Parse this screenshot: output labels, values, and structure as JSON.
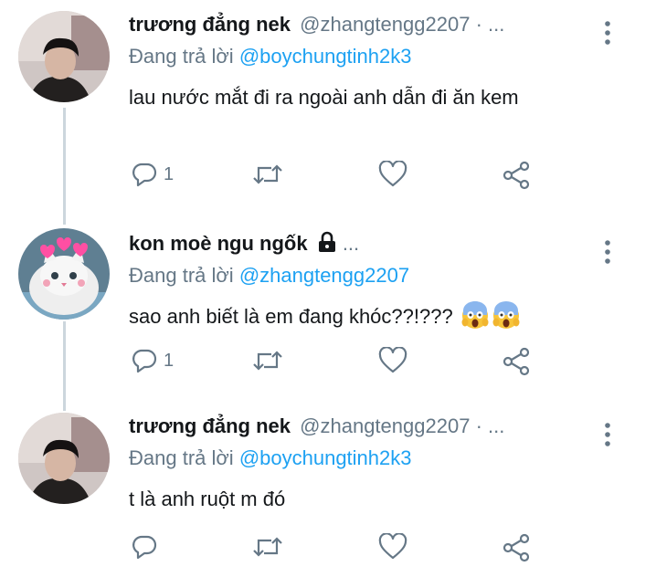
{
  "tweets": [
    {
      "name": "trương đẳng nek",
      "handle": "@zhangtengg2207",
      "meta": "· ...",
      "reply_prefix": "Đang trả lời ",
      "reply_to": "@boychungtinh2k3",
      "text": "lau nước mắt đi ra ngoài anh dẫn đi ăn kem",
      "reply_count": "1",
      "retweet_count": "",
      "like_count": ""
    },
    {
      "name": "kon moè ngu ngốk",
      "locked": true,
      "meta": "...",
      "reply_prefix": "Đang trả lời ",
      "reply_to": "@zhangtengg2207",
      "text": "sao anh biết là em đang khóc??!??? ",
      "emoji": [
        "screaming-face-emoji",
        "screaming-face-emoji"
      ],
      "reply_count": "1",
      "retweet_count": "",
      "like_count": ""
    },
    {
      "name": "trương đẳng nek",
      "handle": "@zhangtengg2207",
      "meta": "· ...",
      "reply_prefix": "Đang trả lời ",
      "reply_to": "@boychungtinh2k3",
      "text": "t là anh ruột m đó",
      "reply_count": "",
      "retweet_count": "",
      "like_count": ""
    }
  ],
  "colors": {
    "text": "#14171a",
    "secondary": "#657786",
    "link": "#1da1f2",
    "thread_line": "#ccd6dd"
  }
}
